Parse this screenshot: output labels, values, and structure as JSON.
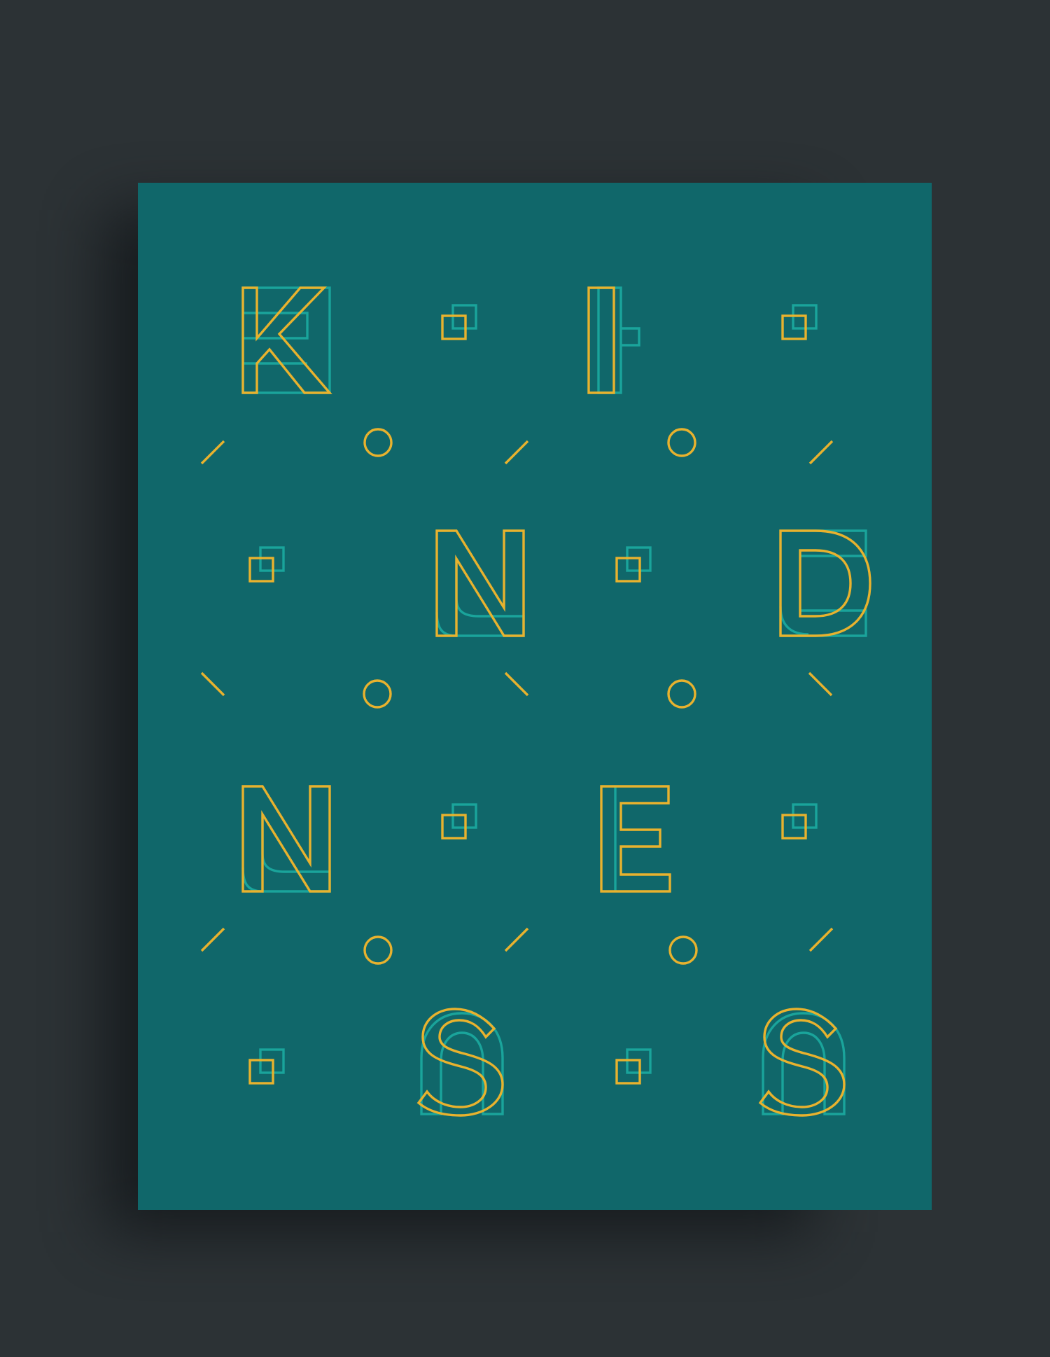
{
  "poster": {
    "letters": [
      "K",
      "I",
      "N",
      "D",
      "N",
      "E",
      "S",
      "S"
    ],
    "colors": {
      "primary": "#e8b22e",
      "secondary": "#1aa49b",
      "background": "#10676a",
      "page": "#2c3235"
    },
    "decorations": [
      "square-pair-icon",
      "circle-icon",
      "slash-icon",
      "backslash-icon"
    ]
  }
}
